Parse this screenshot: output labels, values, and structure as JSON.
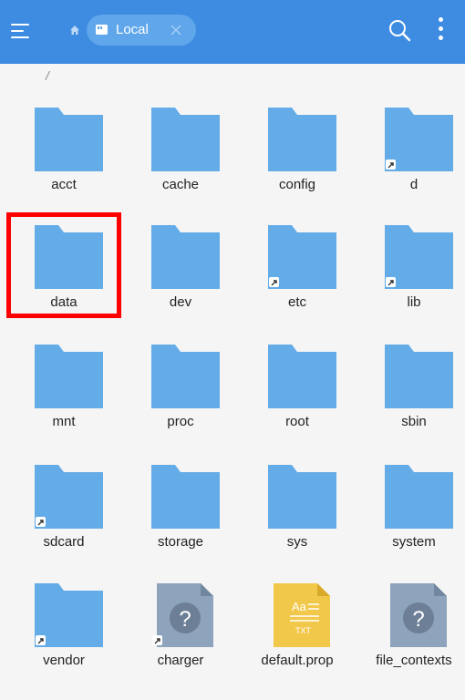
{
  "header": {
    "tab_label": "Local",
    "icons": [
      "menu-icon",
      "home-icon",
      "sd-card-icon",
      "close-icon",
      "search-icon",
      "more-vertical-icon"
    ]
  },
  "path": "/",
  "colors": {
    "header_bg": "#3d8ce2",
    "folder": "#64ace7",
    "highlight": "#ff0000"
  },
  "items": [
    {
      "label": "acct",
      "type": "folder",
      "symlink": false,
      "selected": false
    },
    {
      "label": "cache",
      "type": "folder",
      "symlink": false,
      "selected": false
    },
    {
      "label": "config",
      "type": "folder",
      "symlink": false,
      "selected": false
    },
    {
      "label": "d",
      "type": "folder",
      "symlink": true,
      "selected": false
    },
    {
      "label": "data",
      "type": "folder",
      "symlink": false,
      "selected": true
    },
    {
      "label": "dev",
      "type": "folder",
      "symlink": false,
      "selected": false
    },
    {
      "label": "etc",
      "type": "folder",
      "symlink": true,
      "selected": false
    },
    {
      "label": "lib",
      "type": "folder",
      "symlink": true,
      "selected": false
    },
    {
      "label": "mnt",
      "type": "folder",
      "symlink": false,
      "selected": false
    },
    {
      "label": "proc",
      "type": "folder",
      "symlink": false,
      "selected": false
    },
    {
      "label": "root",
      "type": "folder",
      "symlink": false,
      "selected": false
    },
    {
      "label": "sbin",
      "type": "folder",
      "symlink": false,
      "selected": false
    },
    {
      "label": "sdcard",
      "type": "folder",
      "symlink": true,
      "selected": false
    },
    {
      "label": "storage",
      "type": "folder",
      "symlink": false,
      "selected": false
    },
    {
      "label": "sys",
      "type": "folder",
      "symlink": false,
      "selected": false
    },
    {
      "label": "system",
      "type": "folder",
      "symlink": false,
      "selected": false
    },
    {
      "label": "vendor",
      "type": "folder",
      "symlink": true,
      "selected": false
    },
    {
      "label": "charger",
      "type": "unknown",
      "symlink": true,
      "selected": false
    },
    {
      "label": "default.prop",
      "type": "txt",
      "symlink": false,
      "selected": false
    },
    {
      "label": "file_contexts",
      "type": "unknown",
      "symlink": false,
      "selected": false
    }
  ],
  "file_icon_text": {
    "unknown": "?",
    "txt_top": "Aa",
    "txt_bottom": "TXT"
  }
}
